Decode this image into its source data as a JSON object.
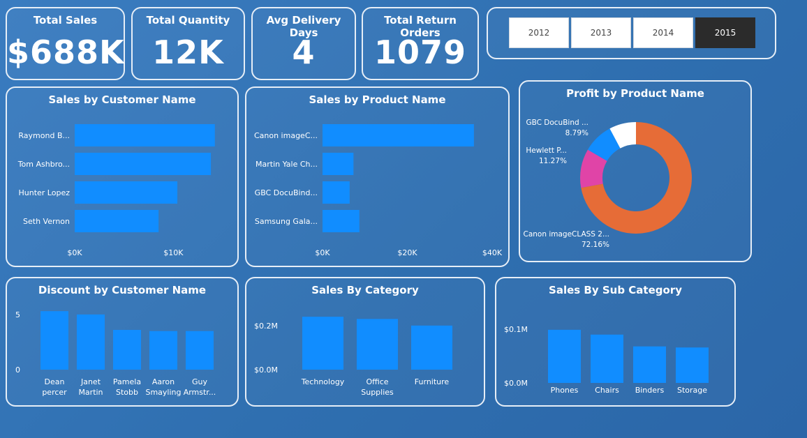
{
  "kpis": [
    {
      "title": "Total Sales",
      "value": "$688K"
    },
    {
      "title": "Total Quantity",
      "value": "12K"
    },
    {
      "title": "Avg Delivery Days",
      "value": "4"
    },
    {
      "title": "Total Return Orders",
      "value": "1079"
    }
  ],
  "year_slicer": {
    "options": [
      "2012",
      "2013",
      "2014",
      "2015"
    ],
    "selected": "2015"
  },
  "colors": {
    "bar": "#118dff",
    "donut": [
      "#e66c37",
      "#e044a7",
      "#118dff",
      "#ffffff"
    ]
  },
  "chart_data": [
    {
      "id": "sales_by_customer",
      "type": "bar",
      "orientation": "horizontal",
      "title": "Sales by Customer Name",
      "categories": [
        "Raymond B...",
        "Tom Ashbro...",
        "Hunter Lopez",
        "Seth Vernon"
      ],
      "values": [
        14200,
        13800,
        10400,
        8500
      ],
      "xlim": [
        0,
        14500
      ],
      "xticks": [
        {
          "v": 0,
          "label": "$0K"
        },
        {
          "v": 10000,
          "label": "$10K"
        }
      ]
    },
    {
      "id": "sales_by_product",
      "type": "bar",
      "orientation": "horizontal",
      "title": "Sales by Product Name",
      "categories": [
        "Canon imageC...",
        "Martin Yale Ch...",
        "GBC DocuBind...",
        "Samsung Gala..."
      ],
      "values": [
        35700,
        7300,
        6400,
        8700
      ],
      "xlim": [
        0,
        40000
      ],
      "xticks": [
        {
          "v": 0,
          "label": "$0K"
        },
        {
          "v": 20000,
          "label": "$20K"
        },
        {
          "v": 40000,
          "label": "$40K"
        }
      ]
    },
    {
      "id": "profit_by_product",
      "type": "pie",
      "donut": true,
      "title": "Profit by Product Name",
      "slices": [
        {
          "label": "Canon imageCLASS 2...",
          "pct_label": "72.16%",
          "value": 72.16
        },
        {
          "label": "Hewlett P...",
          "pct_label": "11.27%",
          "value": 11.27
        },
        {
          "label": "GBC DocuBind ...",
          "pct_label": "8.79%",
          "value": 8.79
        },
        {
          "label": "",
          "pct_label": "",
          "value": 7.78
        }
      ]
    },
    {
      "id": "discount_by_customer",
      "type": "bar",
      "orientation": "vertical",
      "title": "Discount by Customer Name",
      "categories": [
        [
          "Dean",
          "percer"
        ],
        [
          "Janet",
          "Martin"
        ],
        [
          "Pamela",
          "Stobb"
        ],
        [
          "Aaron",
          "Smayling"
        ],
        [
          "Guy",
          "Armstr..."
        ]
      ],
      "values": [
        5.3,
        5.0,
        3.6,
        3.5,
        3.5
      ],
      "ylim": [
        0,
        5.5
      ],
      "yticks": [
        {
          "v": 0,
          "label": "0"
        },
        {
          "v": 5,
          "label": "5"
        }
      ]
    },
    {
      "id": "sales_by_category",
      "type": "bar",
      "orientation": "vertical",
      "title": "Sales By Category",
      "categories": [
        [
          "Technology"
        ],
        [
          "Office",
          "Supplies"
        ],
        [
          "Furniture"
        ]
      ],
      "values": [
        0.24,
        0.23,
        0.2
      ],
      "ylim": [
        0,
        0.25
      ],
      "yticks": [
        {
          "v": 0,
          "label": "$0.0M"
        },
        {
          "v": 0.2,
          "label": "$0.2M"
        }
      ]
    },
    {
      "id": "sales_by_subcategory",
      "type": "bar",
      "orientation": "vertical",
      "title": "Sales By Sub Category",
      "categories": [
        [
          "Phones"
        ],
        [
          "Chairs"
        ],
        [
          "Binders"
        ],
        [
          "Storage"
        ]
      ],
      "values": [
        0.099,
        0.09,
        0.068,
        0.066
      ],
      "ylim": [
        0,
        0.104
      ],
      "yticks": [
        {
          "v": 0,
          "label": "$0.0M"
        },
        {
          "v": 0.1,
          "label": "$0.1M"
        }
      ]
    }
  ]
}
